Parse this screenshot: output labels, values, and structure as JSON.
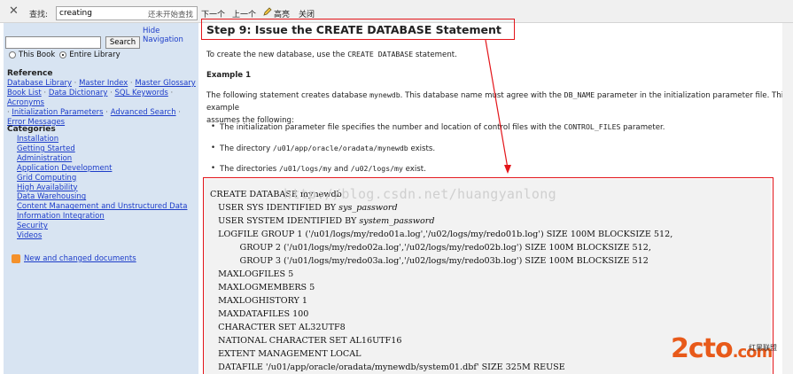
{
  "findbar": {
    "label": "查找:",
    "query": "creating",
    "hint": "还未开始查找",
    "next": "下一个",
    "prev": "上一个",
    "highlight": "高亮",
    "close": "关闭"
  },
  "sidebar": {
    "hide_nav": "Hide Navigation",
    "search_button": "Search",
    "radio_this_book": "This Book",
    "radio_entire_library": "Entire Library",
    "reference_title": "Reference",
    "reference_links": [
      "Database Library",
      "Master Index",
      "Master Glossary",
      "Book List",
      "Data Dictionary",
      "SQL Keywords",
      "Acronyms",
      "Initialization Parameters",
      "Advanced Search",
      "Error Messages"
    ],
    "categories_title": "Categories",
    "categories": [
      "Installation",
      "Getting Started",
      "Administration",
      "Application Development",
      "Grid Computing",
      "High Availability",
      "Data Warehousing",
      "Content Management and Unstructured Data",
      "Information Integration",
      "Security",
      "Videos"
    ],
    "rss_link": "New and changed documents"
  },
  "main": {
    "heading": "Step 9: Issue the CREATE DATABASE Statement",
    "intro_pre": "To create the new database, use the ",
    "intro_code": "CREATE DATABASE",
    "intro_post": " statement.",
    "example_title": "Example 1",
    "example_pre": "The following statement creates database ",
    "example_db": "mynewdb",
    "example_mid": ". This database name must agree with the ",
    "example_param": "DB_NAME",
    "example_post": " parameter in the initialization parameter file. This example",
    "example_line2": "assumes the following:",
    "bullets": [
      {
        "pre": "The initialization parameter file specifies the number and location of control files with the ",
        "code": "CONTROL_FILES",
        "post": " parameter."
      },
      {
        "pre": "The directory ",
        "code": "/u01/app/oracle/oradata/mynewdb",
        "post": " exists."
      },
      {
        "pre": "The directories ",
        "code": "/u01/logs/my",
        "mid": " and ",
        "code2": "/u02/logs/my",
        "post": " exist."
      }
    ],
    "code_lines": [
      "CREATE DATABASE mynewdb",
      "   USER SYS IDENTIFIED BY sys_password",
      "   USER SYSTEM IDENTIFIED BY system_password",
      "   LOGFILE GROUP 1 ('/u01/logs/my/redo01a.log','/u02/logs/my/redo01b.log') SIZE 100M BLOCKSIZE 512,",
      "           GROUP 2 ('/u01/logs/my/redo02a.log','/u02/logs/my/redo02b.log') SIZE 100M BLOCKSIZE 512,",
      "           GROUP 3 ('/u01/logs/my/redo03a.log','/u02/logs/my/redo03b.log') SIZE 100M BLOCKSIZE 512",
      "   MAXLOGFILES 5",
      "   MAXLOGMEMBERS 5",
      "   MAXLOGHISTORY 1",
      "   MAXDATAFILES 100",
      "   CHARACTER SET AL32UTF8",
      "   NATIONAL CHARACTER SET AL16UTF16",
      "   EXTENT MANAGEMENT LOCAL",
      "   DATAFILE '/u01/app/oracle/oradata/mynewdb/system01.dbf' SIZE 325M REUSE"
    ]
  },
  "watermark": "http://blog.csdn.net/huangyanlong",
  "logo": {
    "main": "2cto",
    "dot": ".com",
    "sub": "红黑联盟"
  },
  "colors": {
    "annotation": "#e3151a",
    "link": "#1c3cc9",
    "sidebar_bg": "#d8e4f2",
    "code_bg": "#f2f2f2"
  }
}
